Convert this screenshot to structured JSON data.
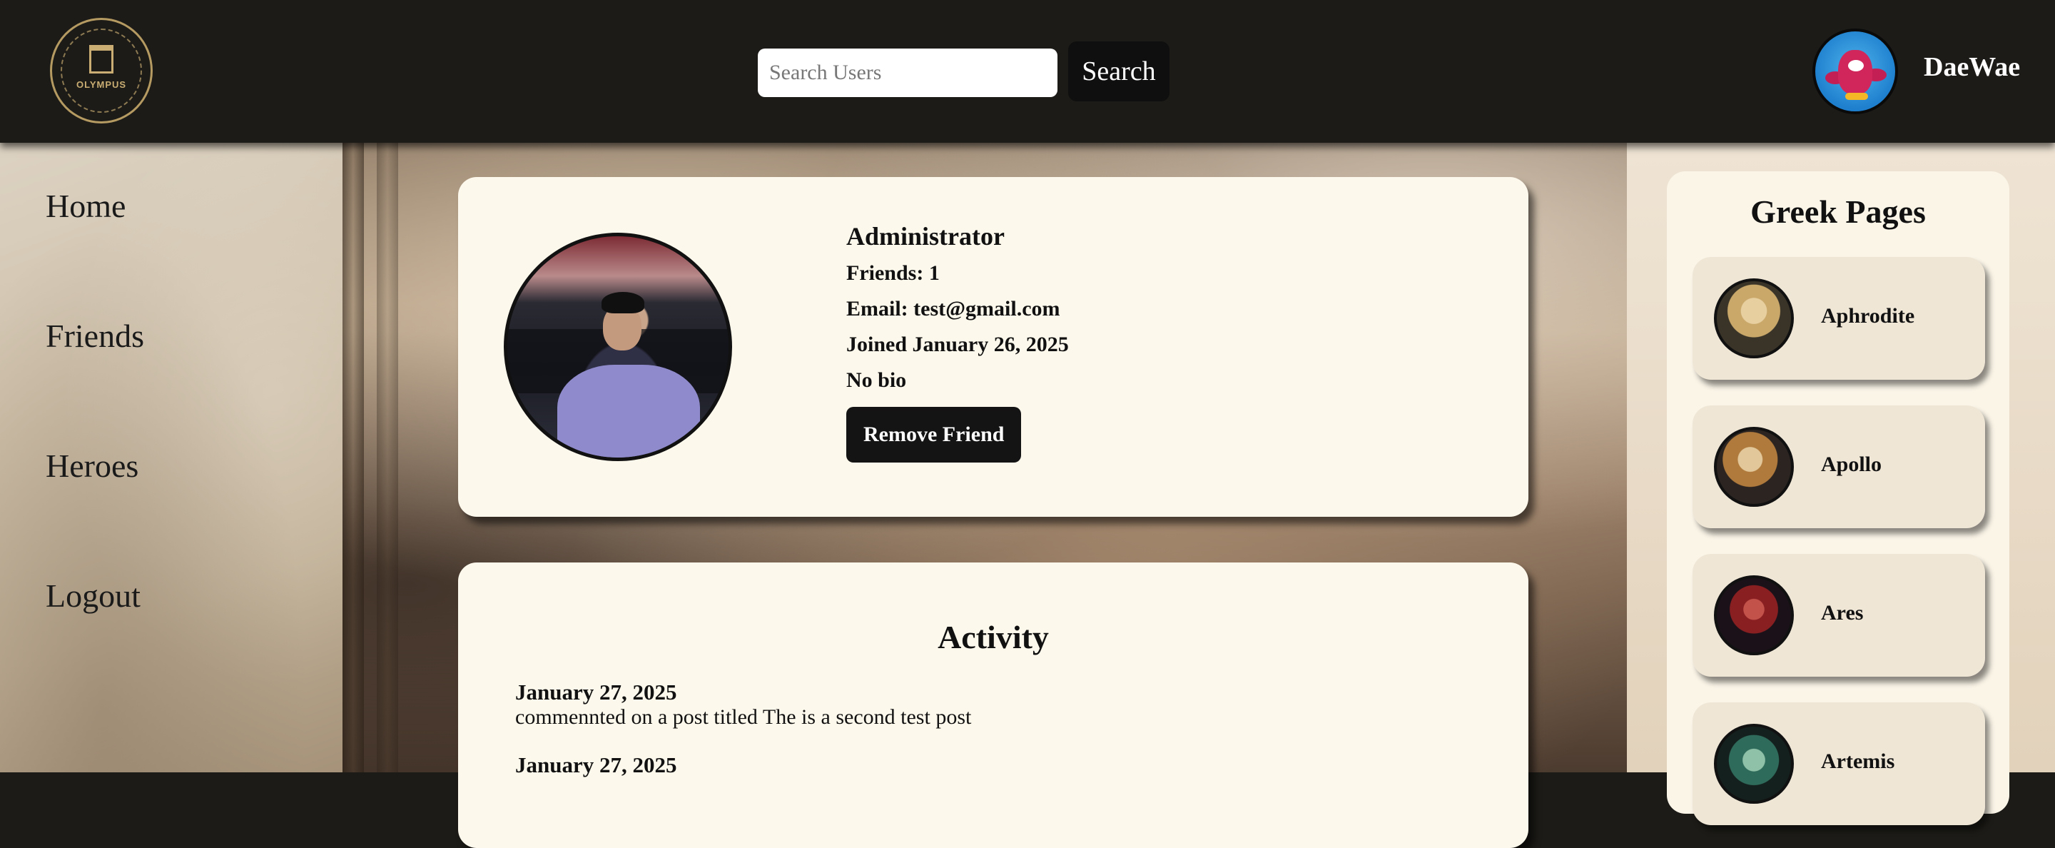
{
  "header": {
    "logo_text": "OLYMPUS",
    "search_placeholder": "Search Users",
    "search_button": "Search",
    "username": "DaeWae"
  },
  "sidebar": {
    "items": [
      {
        "label": "Home"
      },
      {
        "label": "Friends"
      },
      {
        "label": "Heroes"
      },
      {
        "label": "Logout"
      }
    ]
  },
  "profile": {
    "name": "Administrator",
    "friends": "Friends: 1",
    "email": "Email: test@gmail.com",
    "joined": "Joined January 26, 2025",
    "bio": "No bio",
    "action_button": "Remove Friend"
  },
  "activity": {
    "title": "Activity",
    "items": [
      {
        "date": "January 27, 2025",
        "text": "commennted on a post titled The is a second test post"
      },
      {
        "date": "January 27, 2025",
        "text": ""
      }
    ]
  },
  "greek_pages": {
    "title": "Greek Pages",
    "items": [
      {
        "name": "Aphrodite",
        "icon": "aphrodite-portrait",
        "color": "#c9a86a"
      },
      {
        "name": "Apollo",
        "icon": "apollo-portrait",
        "color": "#b07a3c"
      },
      {
        "name": "Ares",
        "icon": "ares-portrait",
        "color": "#8a1f22"
      },
      {
        "name": "Artemis",
        "icon": "artemis-portrait",
        "color": "#2f6b5a"
      }
    ]
  },
  "colors": {
    "header_bg": "#1c1b17",
    "card_bg": "#fdf8ec",
    "button_bg": "#141414"
  }
}
